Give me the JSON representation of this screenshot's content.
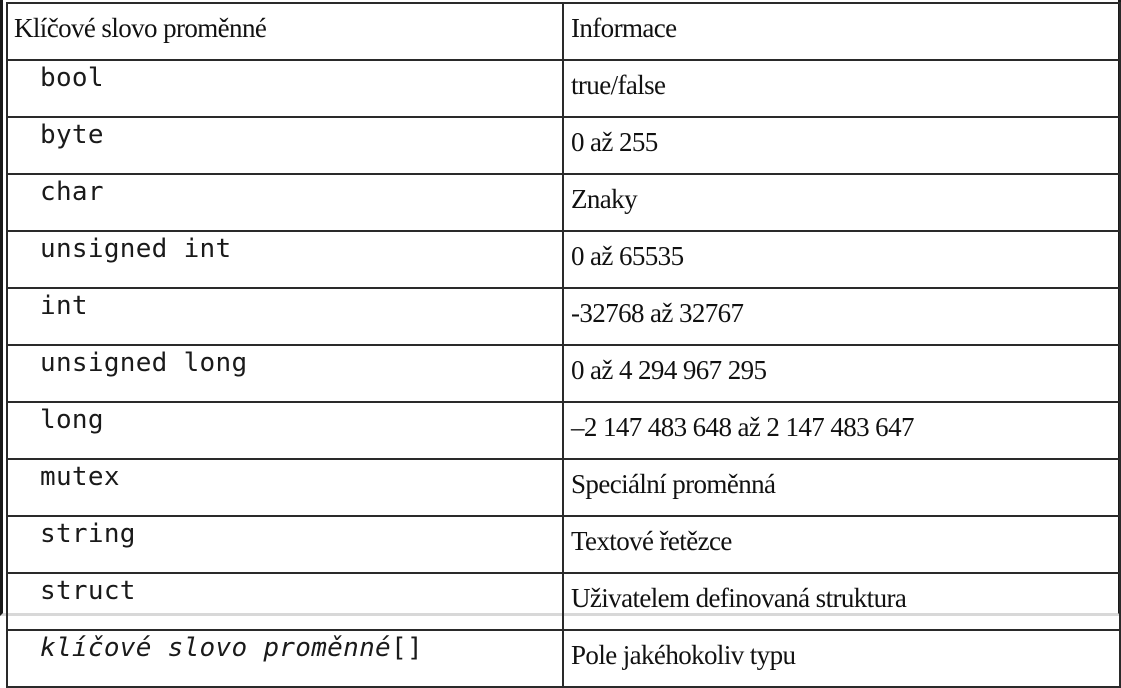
{
  "table": {
    "headers": [
      "Klíčové slovo proměnné",
      "Informace"
    ],
    "rows": [
      {
        "keyword": "bool",
        "info": "true/false"
      },
      {
        "keyword": "byte",
        "info": "0 až 255"
      },
      {
        "keyword": "char",
        "info": "Znaky"
      },
      {
        "keyword": "unsigned int",
        "info": "0 až 65535"
      },
      {
        "keyword": "int",
        "info": "-32768 až 32767"
      },
      {
        "keyword": "unsigned long",
        "info": "0 až 4 294 967 295"
      },
      {
        "keyword": "long",
        "info": "–2 147 483 648 až 2 147 483 647"
      },
      {
        "keyword": "mutex",
        "info": "Speciální proměnná"
      },
      {
        "keyword": "string",
        "info": "Textové řetězce"
      },
      {
        "keyword": "struct",
        "info": "Uživatelem definovaná struktura"
      },
      {
        "keyword_italic": "klíčové slovo proměnné",
        "keyword_suffix": "[]",
        "info": "Pole jakéhokoliv typu"
      }
    ]
  }
}
